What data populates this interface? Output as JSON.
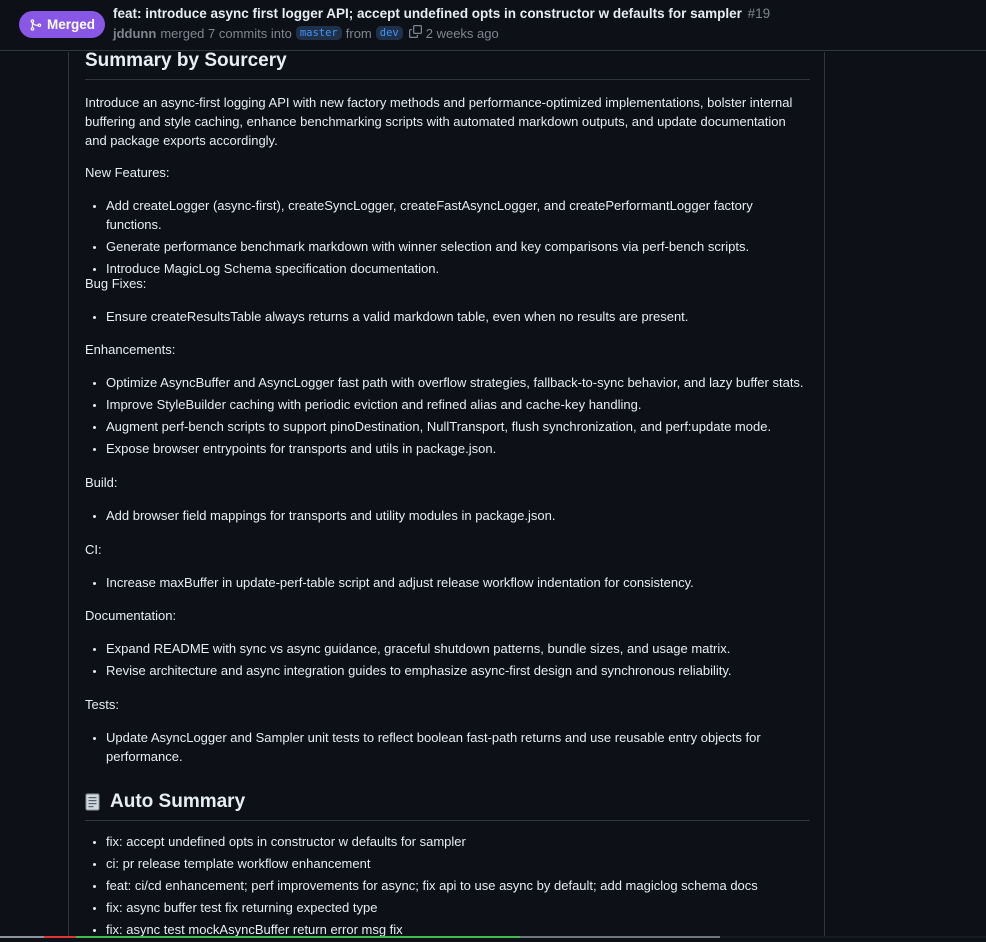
{
  "header": {
    "state": "Merged",
    "title": "feat: introduce async first logger API; accept undefined opts in constructor w defaults for sampler",
    "number": "#19",
    "author": "jddunn",
    "merged_text": "merged 7 commits into",
    "base_branch": "master",
    "from_text": "from",
    "head_branch": "dev",
    "time": "2 weeks ago",
    "icons": {
      "merge": "git-merge-icon",
      "copy": "copy-icon"
    }
  },
  "body": {
    "summary_title": "Summary by Sourcery",
    "intro": "Introduce an async-first logging API with new factory methods and performance-optimized implementations, bolster internal buffering and style caching, enhance benchmarking scripts with automated markdown outputs, and update documentation and package exports accordingly.",
    "sections": [
      {
        "label": "New Features:",
        "items": [
          "Add createLogger (async-first), createSyncLogger, createFastAsyncLogger, and createPerformantLogger factory functions.",
          "Generate performance benchmark markdown with winner selection and key comparisons via perf-bench scripts.",
          "Introduce MagicLog Schema specification documentation."
        ]
      },
      {
        "label": "Bug Fixes:",
        "items": [
          "Ensure createResultsTable always returns a valid markdown table, even when no results are present."
        ]
      },
      {
        "label": "Enhancements:",
        "items": [
          "Optimize AsyncBuffer and AsyncLogger fast path with overflow strategies, fallback-to-sync behavior, and lazy buffer stats.",
          "Improve StyleBuilder caching with periodic eviction and refined alias and cache-key handling.",
          "Augment perf-bench scripts to support pinoDestination, NullTransport, flush synchronization, and perf:update mode.",
          "Expose browser entrypoints for transports and utils in package.json."
        ]
      },
      {
        "label": "Build:",
        "items": [
          "Add browser field mappings for transports and utility modules in package.json."
        ]
      },
      {
        "label": "CI:",
        "items": [
          "Increase maxBuffer in update-perf-table script and adjust release workflow indentation for consistency."
        ]
      },
      {
        "label": "Documentation:",
        "items": [
          "Expand README with sync vs async guidance, graceful shutdown patterns, bundle sizes, and usage matrix.",
          "Revise architecture and async integration guides to emphasize async-first design and synchronous reliability."
        ]
      },
      {
        "label": "Tests:",
        "items": [
          "Update AsyncLogger and Sampler unit tests to reflect boolean fast-path returns and use reusable entry objects for performance."
        ]
      }
    ],
    "auto_summary_title": "Auto Summary",
    "auto_summary_icon": "page-document-icon",
    "auto_items": [
      "fix: accept undefined opts in constructor w defaults for sampler",
      "ci: pr release template workflow enhancement",
      "feat: ci/cd enhancement; perf improvements for async; fix api to use async by default; add magiclog schema docs",
      "fix: async buffer test fix returning expected type",
      "fix: async test mockAsyncBuffer return error msg fix"
    ]
  },
  "colors": {
    "background": "#0d1117",
    "merged_badge": "#8957e5",
    "branch_text": "#4493f8",
    "border": "#30363d",
    "muted": "#7d8590"
  }
}
